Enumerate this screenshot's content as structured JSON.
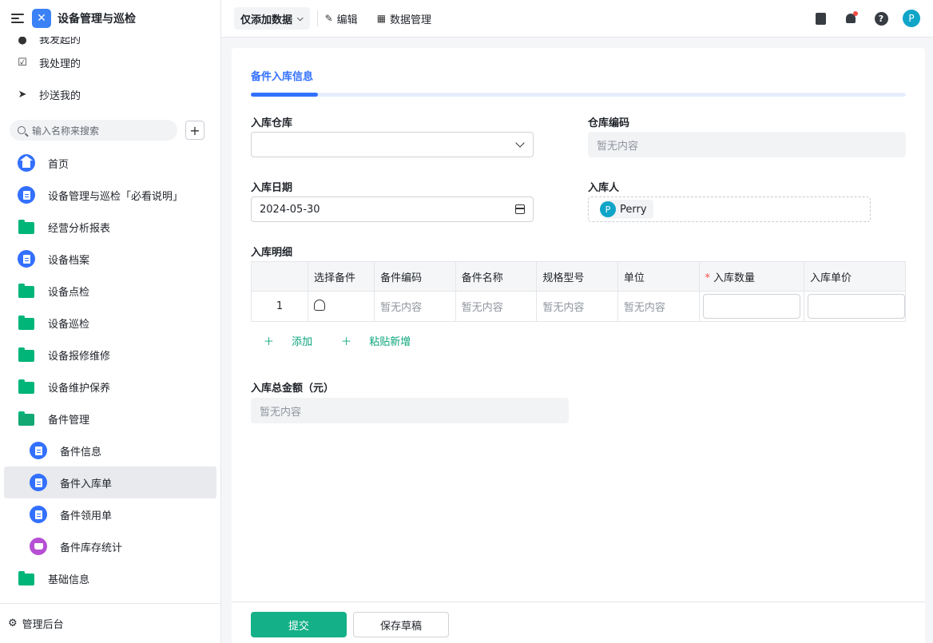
{
  "app": {
    "title": "设备管理与巡检",
    "logo_icon": "tools-icon",
    "brand_color": "#3b82f6"
  },
  "sidebar": {
    "top_items": [
      {
        "label": "我发起的",
        "icon": "circle-icon"
      },
      {
        "label": "我处理的",
        "icon": "checkbox-icon"
      },
      {
        "label": "抄送我的",
        "icon": "send-icon"
      }
    ],
    "search_placeholder": "输入名称来搜索",
    "items": [
      {
        "label": "首页",
        "icon": "home-icon"
      },
      {
        "label": "设备管理与巡检「必看说明」",
        "icon": "document-icon"
      },
      {
        "label": "经营分析报表",
        "icon": "folder-icon"
      },
      {
        "label": "设备档案",
        "icon": "document-icon"
      },
      {
        "label": "设备点检",
        "icon": "folder-icon"
      },
      {
        "label": "设备巡检",
        "icon": "folder-icon"
      },
      {
        "label": "设备报修维修",
        "icon": "folder-icon"
      },
      {
        "label": "设备维护保养",
        "icon": "folder-icon"
      },
      {
        "label": "备件管理",
        "icon": "folder-open-icon"
      },
      {
        "label": "备件信息",
        "icon": "document-icon"
      },
      {
        "label": "备件入库单",
        "icon": "document-icon",
        "active": true
      },
      {
        "label": "备件领用单",
        "icon": "document-icon"
      },
      {
        "label": "备件库存统计",
        "icon": "dashboard-icon"
      },
      {
        "label": "基础信息",
        "icon": "folder-icon"
      }
    ],
    "footer_label": "管理后台"
  },
  "topbar": {
    "mode_label": "仅添加数据",
    "edit_label": "编辑",
    "data_manage_label": "数据管理",
    "avatar_initial": "P"
  },
  "form": {
    "tab_label": "备件入库信息",
    "warehouse_label": "入库仓库",
    "warehouse_value": "",
    "warehouse_code_label": "仓库编码",
    "warehouse_code_value": "暂无内容",
    "date_label": "入库日期",
    "date_value": "2024-05-30",
    "person_label": "入库人",
    "person_name": "Perry",
    "person_initial": "P",
    "detail_label": "入库明细",
    "table": {
      "headers": [
        "",
        "选择备件",
        "备件编码",
        "备件名称",
        "规格型号",
        "单位",
        "入库数量",
        "入库单价"
      ],
      "rows": [
        {
          "index": "1",
          "code": "暂无内容",
          "name": "暂无内容",
          "spec": "暂无内容",
          "unit": "暂无内容"
        }
      ]
    },
    "add_label": "添加",
    "paste_label": "粘贴新增",
    "total_label": "入库总金额（元）",
    "total_value": "暂无内容"
  },
  "footer": {
    "submit_label": "提交",
    "draft_label": "保存草稿",
    "primary_color": "#14b088"
  }
}
